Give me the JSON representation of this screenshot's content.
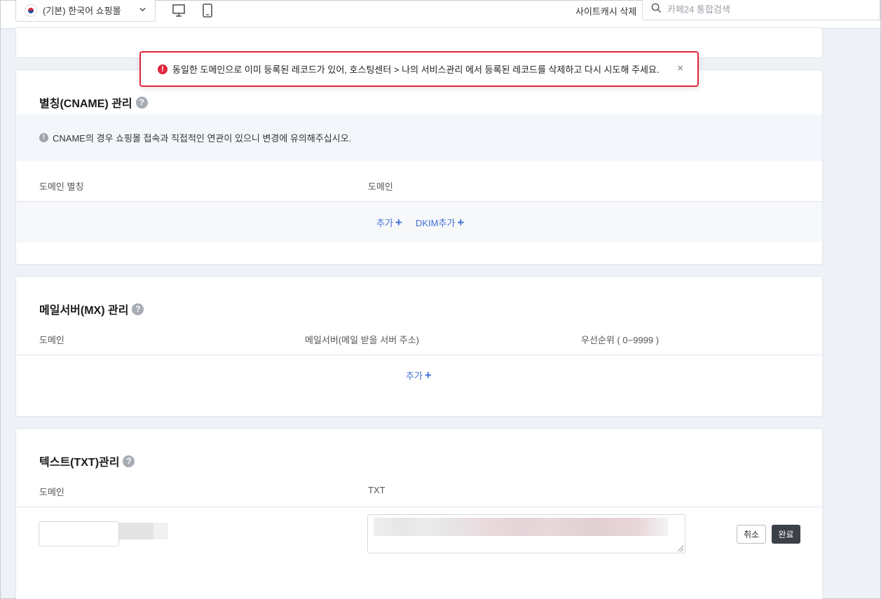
{
  "topbar": {
    "mall_select": "(기본) 한국어 쇼핑몰",
    "site_cache_delete": "사이트캐시 삭제",
    "search_placeholder": "카페24 통합검색"
  },
  "toast": {
    "message": "동일한 도메인으로 이미 등록된 레코드가 있어, 호스팅센터 > 나의 서비스관리 에서 등록된 레코드를 삭제하고 다시 시도해 주세요.",
    "close": "×"
  },
  "cname": {
    "title": "별칭(CNAME) 관리",
    "notice": "CNAME의 경우 쇼핑몰 접속과 직접적인 연관이 있으니 변경에 유의해주십시오.",
    "col_alias": "도메인 별칭",
    "col_domain": "도메인",
    "add": "추가",
    "dkim_add": "DKIM추가"
  },
  "mx": {
    "title": "메일서버(MX) 관리",
    "col_domain": "도메인",
    "col_server": "메일서버(메일 받을 서버 주소)",
    "col_priority": "우선순위 ( 0~9999 )",
    "add": "추가"
  },
  "txt": {
    "title": "텍스트(TXT)관리",
    "col_domain": "도메인",
    "col_txt": "TXT",
    "cancel": "취소",
    "done": "완료"
  },
  "icons": {
    "help": "?",
    "plus": "+",
    "chevron": "⌄",
    "error": "!",
    "info": "!"
  },
  "colors": {
    "accent_link": "#3f6fd8",
    "error": "#e0263f",
    "dark_button": "#3c4048"
  }
}
